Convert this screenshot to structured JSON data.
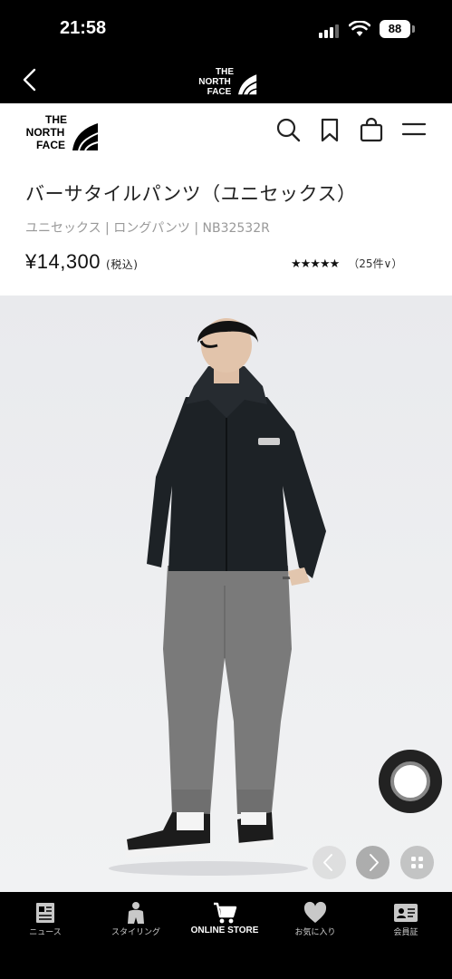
{
  "status": {
    "time": "21:58",
    "battery": "88"
  },
  "brand": {
    "logo_line1": "THE",
    "logo_line2": "NORTH",
    "logo_line3": "FACE"
  },
  "product": {
    "title": "バーサタイルパンツ（ユニセックス）",
    "meta": "ユニセックス | ロングパンツ | NB32532R",
    "price": "¥14,300",
    "tax_note": "(税込)",
    "stars": "★★★★★",
    "review_count": "（25件∨）"
  },
  "tabs": [
    {
      "label": "ニュース",
      "icon": "news-icon"
    },
    {
      "label": "スタイリング",
      "icon": "styling-icon"
    },
    {
      "label": "ONLINE STORE",
      "icon": "cart-icon"
    },
    {
      "label": "お気に入り",
      "icon": "heart-icon"
    },
    {
      "label": "会員証",
      "icon": "member-card-icon"
    }
  ],
  "colors": {
    "background": "#000000",
    "surface": "#ffffff",
    "meta_text": "#999999"
  }
}
